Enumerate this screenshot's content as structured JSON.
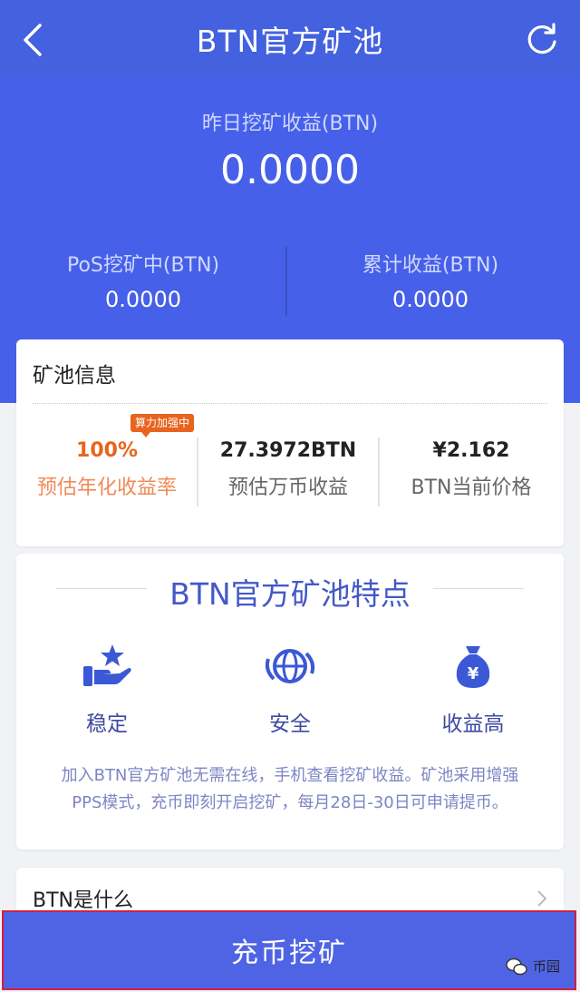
{
  "header": {
    "title": "BTN官方矿池"
  },
  "summary": {
    "yesterday_label": "昨日挖矿收益(BTN)",
    "yesterday_value": "0.0000",
    "pos_label": "PoS挖矿中(BTN)",
    "pos_value": "0.0000",
    "total_label": "累计收益(BTN)",
    "total_value": "0.0000"
  },
  "pool_info": {
    "title": "矿池信息",
    "badge": "算力加强中",
    "stats": [
      {
        "value": "100%",
        "label": "预估年化收益率"
      },
      {
        "value": "27.3972BTN",
        "label": "预估万币收益"
      },
      {
        "value": "¥2.162",
        "label": "BTN当前价格"
      }
    ]
  },
  "features": {
    "title": "BTN官方矿池特点",
    "items": [
      {
        "label": "稳定",
        "icon": "hand-star-icon"
      },
      {
        "label": "安全",
        "icon": "globe-shield-icon"
      },
      {
        "label": "收益高",
        "icon": "money-bag-icon"
      }
    ],
    "description_line1": "加入BTN官方矿池无需在线，手机查看挖矿收益。矿池采用增强",
    "description_line2": "PPS模式，充币即刻开启挖矿，每月28日-30日可申请提币。"
  },
  "what_is": {
    "title": "BTN是什么"
  },
  "cta": {
    "label": "充币挖矿"
  },
  "watermark": {
    "text": "币园"
  },
  "colors": {
    "primary": "#4760e9",
    "header": "#4461df",
    "accent_orange": "#e8641e",
    "feature_text": "#4458c8"
  }
}
